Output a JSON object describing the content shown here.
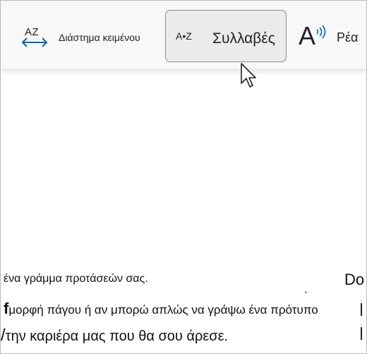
{
  "toolbar": {
    "text_spacing": {
      "icon_text": "AZ",
      "icon_name": "text-spacing-icon",
      "label": "Διάστημα κειμένου"
    },
    "syllables": {
      "icon_text": "A•Z",
      "icon_name": "syllables-icon",
      "label": "Συλλαβές",
      "state": "hovered"
    },
    "read_aloud": {
      "icon_text": "A",
      "icon_name": "read-aloud-icon",
      "label": "Ρέα"
    }
  },
  "document": {
    "line1": "ένα γράμμα προτάσεών σας.",
    "line2_fragment": "f",
    "line2": "μορφή πάγου ή αν μπορώ απλώς να γράψω ένα πρότυπο",
    "line3_fragment": "/",
    "line3": "την καριέρα μας που θα σου άρεσε.",
    "stray_mark": "ˎ",
    "right_column_text": "Do"
  },
  "colors": {
    "toolbar_bg": "#f8f8f8",
    "hover_bg": "#ebebeb",
    "hover_border": "#8e8e8e",
    "icon_accent": "#0067c0",
    "text": "#1f1f1f"
  }
}
